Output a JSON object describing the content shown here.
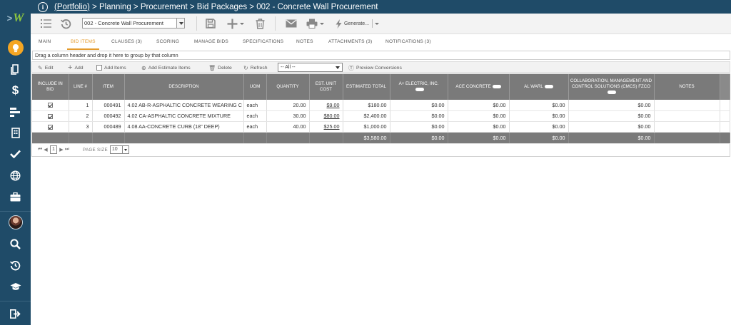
{
  "app": {
    "logo_text": "W",
    "colors": {
      "sidebar": "#1f4b68",
      "accent_orange": "#e49a2b",
      "bulb": "#f5a623",
      "logo_green": "#8dc63f",
      "grid_header": "#7a7a7a"
    }
  },
  "sidebar": {
    "items": [
      {
        "icon": "lightbulb-icon"
      },
      {
        "icon": "document-icon"
      },
      {
        "icon": "dollar-icon"
      },
      {
        "icon": "gantt-bars-icon"
      },
      {
        "icon": "building-icon"
      },
      {
        "icon": "checkmark-icon"
      },
      {
        "icon": "globe-icon"
      },
      {
        "icon": "briefcase-icon"
      },
      {
        "icon": "user-avatar"
      },
      {
        "icon": "search-icon"
      },
      {
        "icon": "history-icon"
      },
      {
        "icon": "graduation-cap-icon"
      },
      {
        "icon": "logout-icon"
      }
    ]
  },
  "header": {
    "portfolio_link": "(Portfolio)",
    "breadcrumb_rest": " > Planning > Procurement > Bid Packages > 002 - Concrete Wall Procurement"
  },
  "toolbar": {
    "package_select_value": "002 - Concrete Wall Procurement",
    "generate_label": "Generate..."
  },
  "tabs": [
    {
      "label": "MAIN",
      "active": false
    },
    {
      "label": "BID ITEMS",
      "active": true
    },
    {
      "label": "CLAUSES (3)",
      "active": false
    },
    {
      "label": "SCORING",
      "active": false
    },
    {
      "label": "MANAGE BIDS",
      "active": false
    },
    {
      "label": "SPECIFICATIONS",
      "active": false
    },
    {
      "label": "NOTES",
      "active": false
    },
    {
      "label": "ATTACHMENTS (3)",
      "active": false
    },
    {
      "label": "NOTIFICATIONS (3)",
      "active": false
    }
  ],
  "group_panel_text": "Drag a column header and drop it here to group by that column",
  "grid_toolbar": {
    "edit": "Edit",
    "add": "Add",
    "add_items": "Add Items",
    "add_estimate_items": "Add Estimate Items",
    "delete": "Delete",
    "refresh": "Refresh",
    "filter_value": "-- All --",
    "preview_conversions": "Preview Conversions"
  },
  "grid": {
    "columns": [
      "INCLUDE IN BID",
      "LINE #",
      "ITEM",
      "DESCRIPTION",
      "UOM",
      "QUANTITY",
      "EST. UNIT COST",
      "ESTIMATED TOTAL",
      "A+ ELECTRIC, INC.",
      "ACE CONCRETE",
      "AL WARL",
      "COLLABORATION, MANAGEMENT AND CONTROL SOLUTIONS (CMCS) FZCO",
      "NOTES"
    ],
    "rows": [
      {
        "line": "1",
        "item": "000491",
        "description": "4.02 AB-R-ASPHALTIC CONCRETE WEARING C",
        "uom": "each",
        "quantity": "20.00",
        "unit_cost": "$9.00",
        "total": "$180.00",
        "v1": "$0.00",
        "v2": "$0.00",
        "v3": "$0.00",
        "v4": "$0.00",
        "notes": ""
      },
      {
        "line": "2",
        "item": "000492",
        "description": "4.02 CA-ASPHALTIC CONCRETE MIXTURE",
        "uom": "each",
        "quantity": "30.00",
        "unit_cost": "$80.00",
        "total": "$2,400.00",
        "v1": "$0.00",
        "v2": "$0.00",
        "v3": "$0.00",
        "v4": "$0.00",
        "notes": ""
      },
      {
        "line": "3",
        "item": "000489",
        "description": "4.08 AA-CONCRETE CURB (18\" DEEP)",
        "uom": "each",
        "quantity": "40.00",
        "unit_cost": "$25.00",
        "total": "$1,000.00",
        "v1": "$0.00",
        "v2": "$0.00",
        "v3": "$0.00",
        "v4": "$0.00",
        "notes": ""
      }
    ],
    "footer": {
      "total": "$3,580.00",
      "v1": "$0.00",
      "v2": "$0.00",
      "v3": "$0.00",
      "v4": "$0.00"
    }
  },
  "pager": {
    "current_page": "1",
    "page_size_label": "PAGE SIZE",
    "page_size_value": "10"
  }
}
